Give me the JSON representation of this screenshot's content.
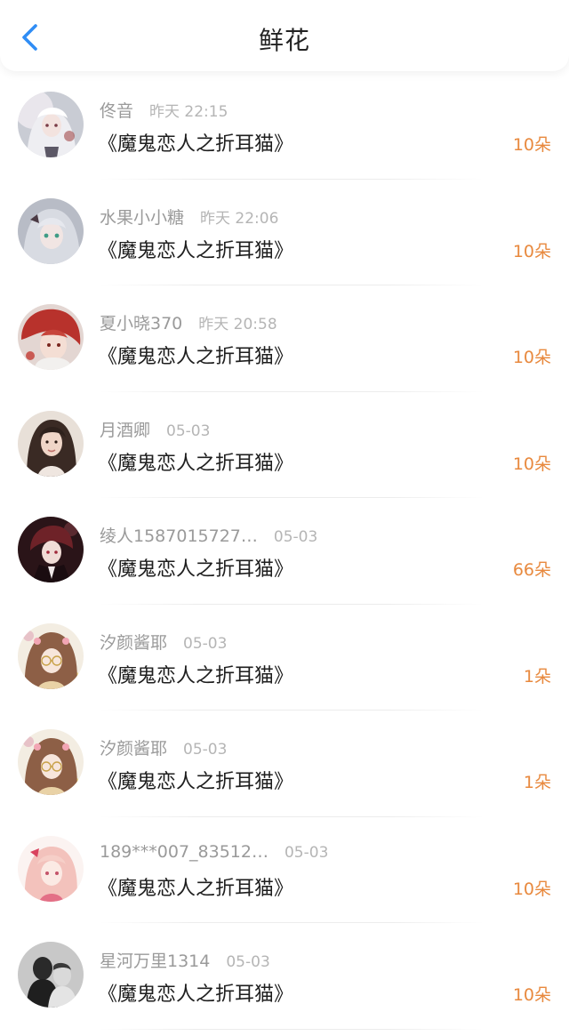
{
  "header": {
    "title": "鲜花",
    "back_icon": "chevron-left-icon"
  },
  "colors": {
    "accent_blue": "#2f8df5",
    "flower_count": "#e8893e",
    "username": "#9a9a9a",
    "time": "#b5b5b5",
    "title_text": "#1e1e1e"
  },
  "records": [
    {
      "user": "佟音",
      "time": "昨天 22:15",
      "book": "《魔鬼恋人之折耳猫》",
      "count": "10朵",
      "avatar": "avatar-white-hair-girl"
    },
    {
      "user": "水果小小糖",
      "time": "昨天 22:06",
      "book": "《魔鬼恋人之折耳猫》",
      "count": "10朵",
      "avatar": "avatar-silver-hair-girl"
    },
    {
      "user": "夏小晓370",
      "time": "昨天 20:58",
      "book": "《魔鬼恋人之折耳猫》",
      "count": "10朵",
      "avatar": "avatar-red-hair-boy"
    },
    {
      "user": "月酒卿",
      "time": "05-03",
      "book": "《魔鬼恋人之折耳猫》",
      "count": "10朵",
      "avatar": "avatar-photo-woman"
    },
    {
      "user": "绫人1587015727…",
      "time": "05-03",
      "book": "《魔鬼恋人之折耳猫》",
      "count": "66朵",
      "avatar": "avatar-dark-anime-boy"
    },
    {
      "user": "汐颜酱耶",
      "time": "05-03",
      "book": "《魔鬼恋人之折耳猫》",
      "count": "1朵",
      "avatar": "avatar-glasses-girl"
    },
    {
      "user": "汐颜酱耶",
      "time": "05-03",
      "book": "《魔鬼恋人之折耳猫》",
      "count": "1朵",
      "avatar": "avatar-glasses-girl"
    },
    {
      "user": "189***007_83512…",
      "time": "05-03",
      "book": "《魔鬼恋人之折耳猫》",
      "count": "10朵",
      "avatar": "avatar-pink-hair-girl"
    },
    {
      "user": "星河万里1314",
      "time": "05-03",
      "book": "《魔鬼恋人之折耳猫》",
      "count": "10朵",
      "avatar": "avatar-couple-silhouette"
    }
  ]
}
